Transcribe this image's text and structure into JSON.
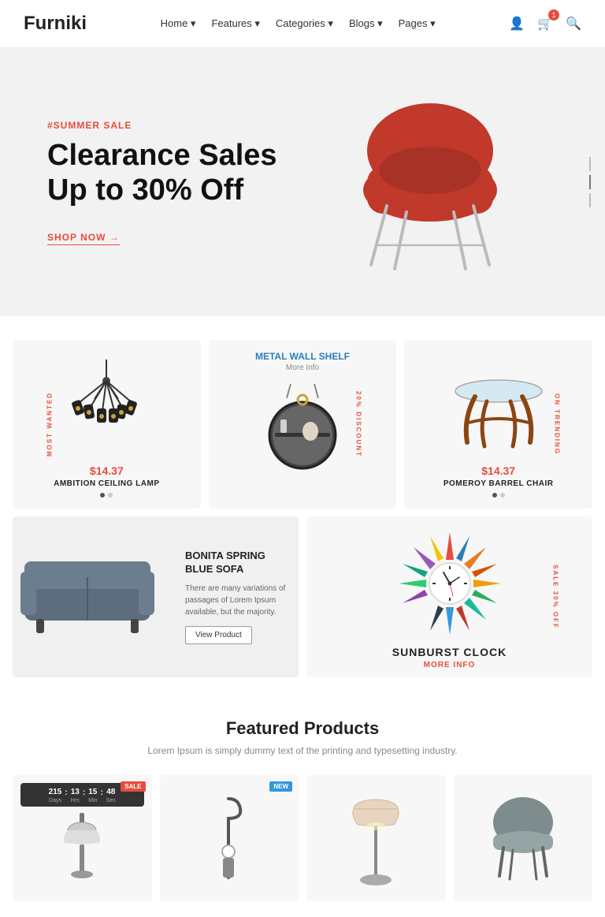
{
  "brand": "Furniki",
  "nav": {
    "links": [
      "Home",
      "Features",
      "Categories",
      "Blogs",
      "Pages"
    ],
    "icons": [
      "user",
      "cart",
      "search"
    ],
    "cart_count": "1"
  },
  "hero": {
    "tag": "#SUMMER SALE",
    "title": "Clearance Sales\nUp to 30% Off",
    "cta": "SHOP NOW →"
  },
  "products": {
    "tag_most_wanted": "MOST WANTED",
    "tag_on_trending": "ON TRENDING",
    "tag_20_discount": "20% DISCOUNT",
    "tag_sale_30": "SALE 30% OFF",
    "item1": {
      "price": "$14.37",
      "name": "AMBITION CEILING LAMP"
    },
    "item2": {
      "label": "METAL WALL SHELF",
      "more_info": "More Info"
    },
    "item3": {
      "price": "$14.37",
      "name": "POMEROY BARREL CHAIR"
    },
    "wide1": {
      "title": "BONITA SPRING BLUE SOFA",
      "desc": "There are many variations of passages of Lorem Ipsum available, but the majority.",
      "btn": "View Product"
    },
    "wide2": {
      "title": "SUNBURST CLOCK",
      "more_info": "MORE INFO"
    }
  },
  "featured": {
    "title": "Featured Products",
    "subtitle": "Lorem Ipsum is simply dummy text of the printing and typesetting industry.",
    "cards": [
      {
        "badge": "SALE",
        "badge_type": "sale"
      },
      {
        "badge": "NEW",
        "badge_type": "new"
      },
      {},
      {}
    ],
    "countdown": {
      "days_label": "Days",
      "hrs_label": "Hrs",
      "min_label": "Min",
      "sec_label": "Sec",
      "days": "215",
      "hrs": "13",
      "min": "15",
      "sec": "48"
    }
  }
}
